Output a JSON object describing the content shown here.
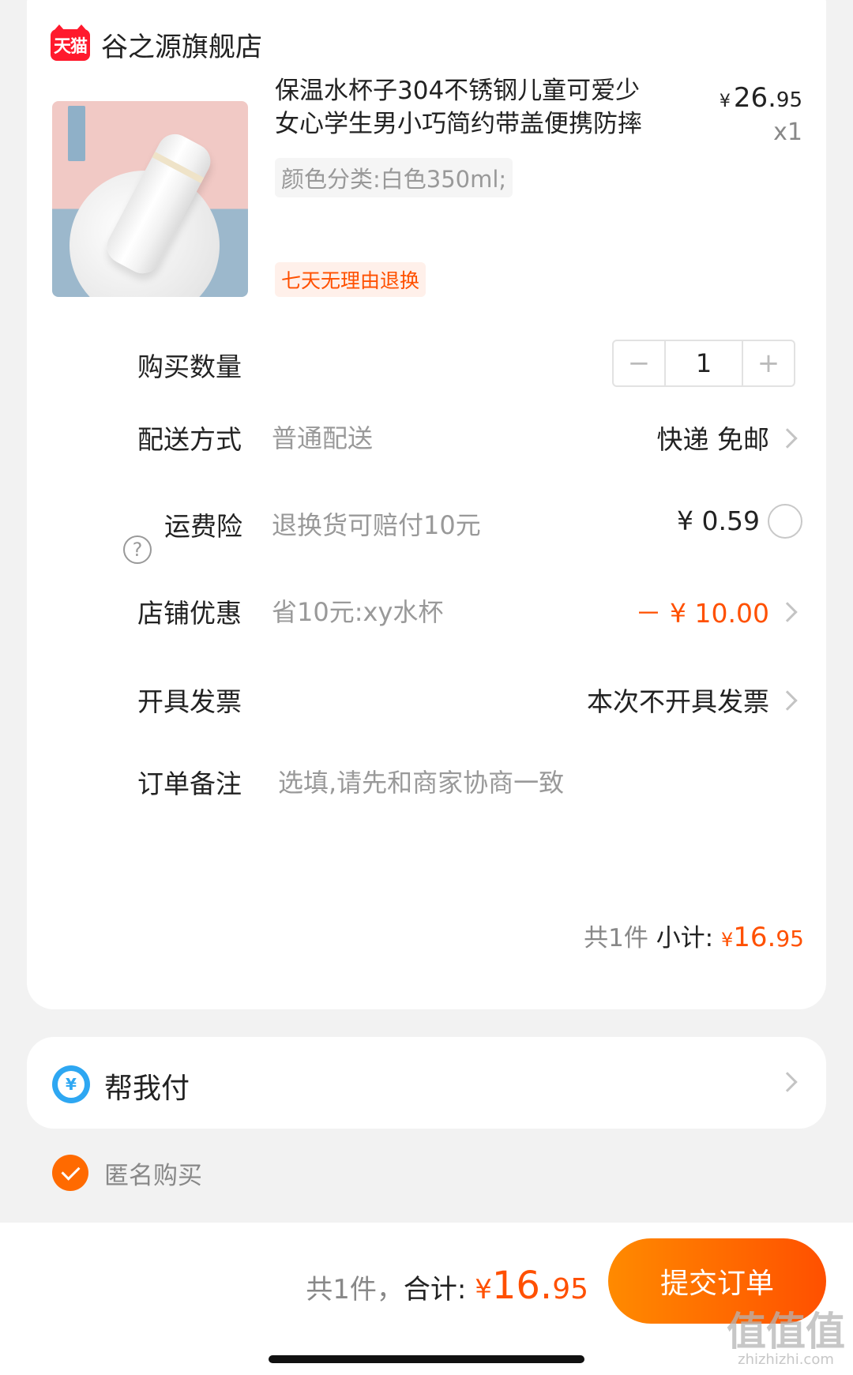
{
  "store": {
    "badge": "天猫",
    "name": "谷之源旗舰店"
  },
  "product": {
    "title": "保温水杯子304不锈钢儿童可爱少女心学生男小巧简约带盖便携防摔",
    "price_symbol": "¥",
    "price_int": "26.",
    "price_cents": "95",
    "qty": "x1",
    "sku": "颜色分类:白色350ml;",
    "return_policy": "七天无理由退换"
  },
  "quantity": {
    "label": "购买数量",
    "minus": "−",
    "value": "1",
    "plus": "+"
  },
  "delivery": {
    "label": "配送方式",
    "value": "普通配送",
    "right": "快递 免邮"
  },
  "shipping_insurance": {
    "help": "?",
    "label": "运费险",
    "value": "退换货可赔付10元",
    "price": "¥ 0.59"
  },
  "store_discount": {
    "label": "店铺优惠",
    "value": "省10元:xy水杯",
    "amount": "－ ¥ 10.00"
  },
  "invoice": {
    "label": "开具发票",
    "value": "本次不开具发票"
  },
  "note": {
    "label": "订单备注",
    "placeholder": "选填,请先和商家协商一致"
  },
  "subtotal": {
    "count": "共1件",
    "label": "小计:",
    "symbol": "¥",
    "int": "16.",
    "cents": "95"
  },
  "pay_for_me": {
    "icon_glyph": "¥",
    "label": "帮我付"
  },
  "anonymous": {
    "label": "匿名购买",
    "checked": true
  },
  "footer": {
    "count": "共1件，",
    "label": "合计:",
    "symbol": "¥",
    "int": "16.",
    "cents": "95",
    "submit": "提交订单"
  },
  "watermark": {
    "text": "值值值",
    "sub": "zhizhizhi.com"
  },
  "colors": {
    "accent": "#ff5000",
    "tmall_red": "#ff1a2d",
    "pay_blue": "#2ea7f2"
  }
}
